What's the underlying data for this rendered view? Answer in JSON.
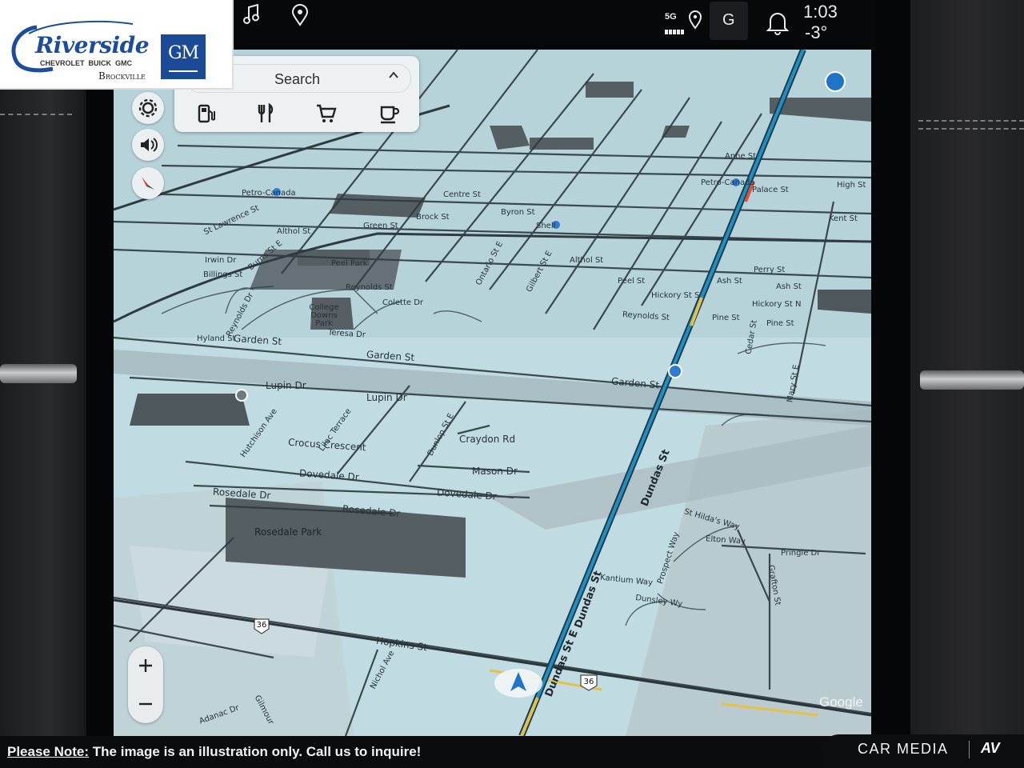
{
  "status": {
    "time": "1:03",
    "temperature": "-3°",
    "network": "5G",
    "profile_initial": "G"
  },
  "map": {
    "search_label": "Search",
    "categories": [
      "gas-icon",
      "restaurant-icon",
      "shopping-icon",
      "coffee-icon"
    ],
    "attribution": "Google",
    "highway_shield": "36",
    "labels": {
      "dundas_st_main": "Dundas St",
      "dundas_st_e_lower": "Dundas St E",
      "dundas_st_lower": "Dundas St",
      "garden_st_1": "Garden St",
      "garden_st_2": "Garden St",
      "garden_st_3": "Garden St",
      "lupin_dr_1": "Lupin Dr",
      "lupin_dr_2": "Lupin Dr",
      "hutchison_ave": "Hutchison Ave",
      "lilac_terrace": "Lilac Terrace",
      "crocus_crescent": "Crocus Crescent",
      "dunlop_st_e": "Dunlop St E",
      "craydon_rd": "Craydon Rd",
      "mason_dr": "Mason Dr",
      "dovedale_dr_1": "Dovedale Dr",
      "dovedale_dr_2": "Dovedale Dr",
      "rosedale_dr_1": "Rosedale Dr",
      "rosedale_dr_2": "Rosedale Dr",
      "rosedale_park": "Rosedale Park",
      "hopkins_st": "Hopkins St",
      "nichol_ave": "Nichol Ave",
      "adanac_dr": "Adanac Dr",
      "gilmour": "Gilmour",
      "st_hildas_way": "St Hilda's Way",
      "elton_way": "Elton Way",
      "pringle_dr": "Pringle Dr",
      "kantium_way": "Kantium Way",
      "prospect_way": "Prospect Way",
      "dunsley_wy": "Dunsley Wy",
      "grafton_st": "Grafton St",
      "hyland_st": "Hyland St",
      "teresa_dr": "Teresa Dr",
      "reynolds_st_1": "Reynolds St",
      "reynolds_st_2": "Reynolds St",
      "reynolds_dr": "Reynolds Dr",
      "college_downs_park": "College Downs Park",
      "colette_dr": "Colette Dr",
      "peel_park": "Peel Park",
      "burns_st_e": "Burns St E",
      "irwin_dr": "Irwin Dr",
      "billings_st": "Billings St",
      "hickory_st_s": "Hickory St S",
      "hickory_st_n": "Hickory St N",
      "pine_st_1": "Pine St",
      "pine_st_2": "Pine St",
      "peel_st": "Peel St",
      "ash_st_1": "Ash St",
      "ash_st_2": "Ash St",
      "althol_st_1": "Althol St",
      "althol_st_2": "Althol St",
      "perry_st": "Perry St",
      "cedar_st": "Cedar St",
      "mary_st_e": "Mary St E",
      "green_st": "Green St",
      "brock_st": "Brock St",
      "byron_st": "Byron St",
      "centre_st": "Centre St",
      "shell": "Shell",
      "petro_canada_1": "Petro-Canada",
      "petro_canada_2": "Petro-Canada",
      "st_lawrence_st": "St Lawrence St",
      "anne_st": "Anne St",
      "palace_st": "Palace St",
      "high_st": "High St",
      "kent_st": "Kent St",
      "ontario_st_e": "Ontario St E",
      "gilbert_st_e": "Gilbert St E"
    }
  },
  "dealer": {
    "name": "Riverside",
    "brands": "CHEVROLET  BUICK  GMC",
    "city": "Brockville",
    "corp_logo": "GM"
  },
  "footer": {
    "note_lead": "Please Note:",
    "note_text": " The image is an illustration only. Call us to inquire!",
    "brand": "CAR MEDIA",
    "brand_mark": "AV"
  }
}
